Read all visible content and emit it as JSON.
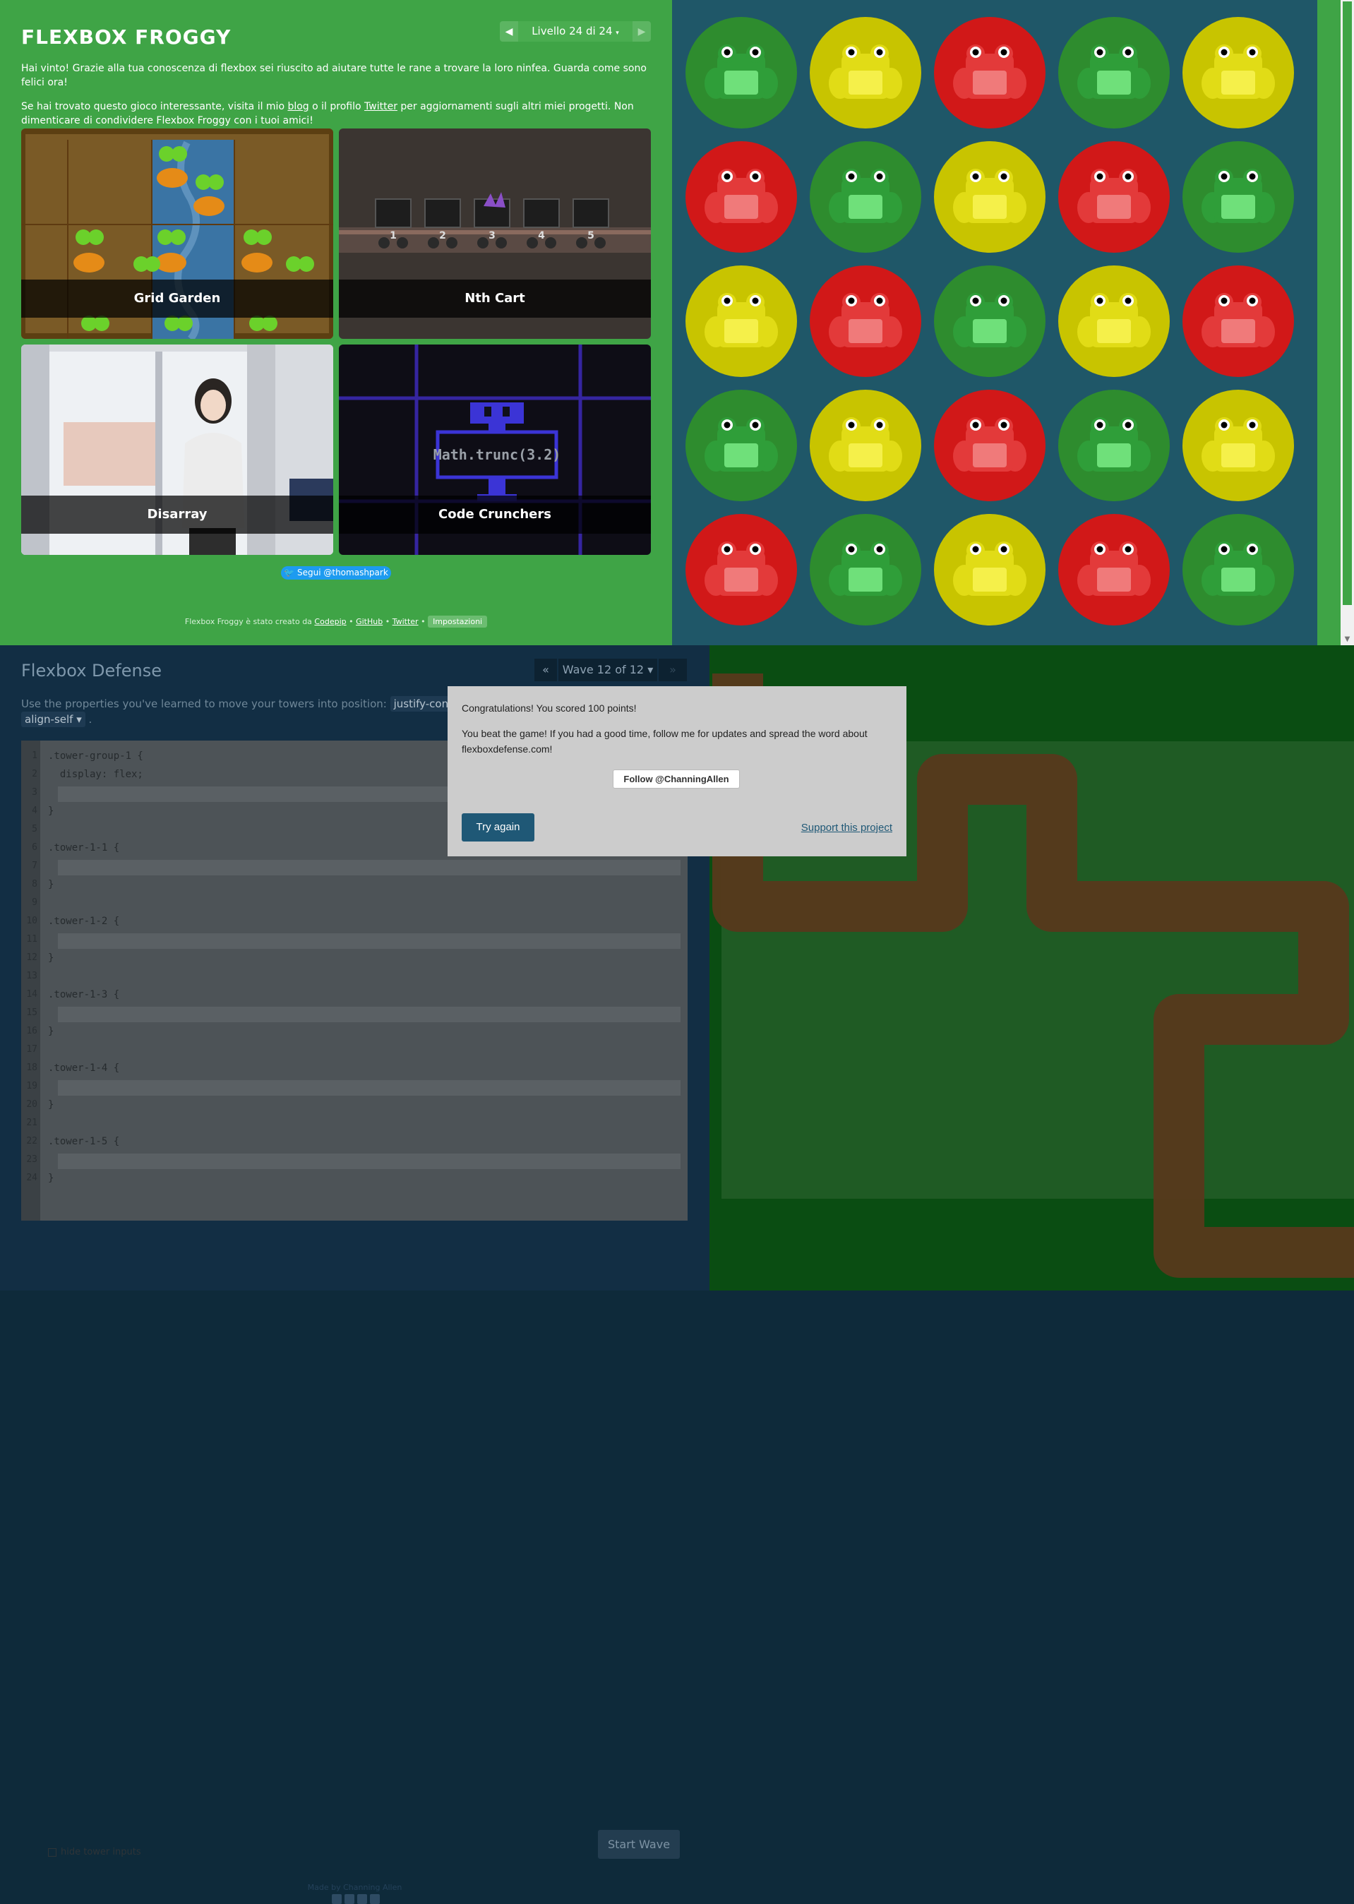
{
  "froggy": {
    "title": "FLEXBOX FROGGY",
    "level_label": "Livello 24 di 24",
    "prev_icon": "triangle-left-icon",
    "next_icon": "triangle-right-icon",
    "win_text": "Hai vinto! Grazie alla tua conoscenza di flexbox sei riuscito ad aiutare tutte le rane a trovare la loro ninfea. Guarda come sono felici ora!",
    "p2_pre": "Se hai trovato questo gioco interessante, visita il mio ",
    "p2_blog": "blog",
    "p2_mid": " o il profilo ",
    "p2_twitter": "Twitter",
    "p2_post": " per aggiornamenti sugli altri miei progetti. Non dimenticare di condividere Flexbox Froggy con i tuoi amici!",
    "games": [
      {
        "label": "Grid Garden"
      },
      {
        "label": "Nth Cart"
      },
      {
        "label": "Disarray"
      },
      {
        "label": "Code Crunchers"
      }
    ],
    "cart_numbers": [
      "1",
      "2",
      "3",
      "4",
      "5"
    ],
    "code_cruncher_text": "Math.trunc(3.2)",
    "twitter_follow": "Segui @thomashpark",
    "footer_pre": "Flexbox Froggy è stato creato da ",
    "footer_codepip": "Codepip",
    "footer_github": "GitHub",
    "footer_twitter": "Twitter",
    "footer_settings": "Impostazioni",
    "pond_colors": {
      "green": "#2e8c2e",
      "yellow": "#c8c400",
      "red": "#d11818"
    },
    "frog_grid": [
      [
        "green",
        "yellow",
        "red",
        "green",
        "yellow"
      ],
      [
        "red",
        "green",
        "yellow",
        "red",
        "green"
      ],
      [
        "yellow",
        "red",
        "green",
        "yellow",
        "red"
      ],
      [
        "green",
        "yellow",
        "red",
        "green",
        "yellow"
      ],
      [
        "red",
        "green",
        "yellow",
        "red",
        "green"
      ]
    ]
  },
  "defense": {
    "title": "Flexbox Defense",
    "wave_prev": "«",
    "wave_label": "Wave 12 of 12",
    "wave_next": "»",
    "desc_pre": "Use the properties you've learned to move your towers into position: ",
    "kw1": "justify-content",
    "kw2": "align-self",
    "code_lines": [
      ".tower-group-1 {",
      "  display: flex;",
      "",
      "}",
      "",
      ".tower-1-1 {",
      "",
      "}",
      "",
      ".tower-1-2 {",
      "",
      "}",
      "",
      ".tower-1-3 {",
      "",
      "}",
      "",
      ".tower-1-4 {",
      "",
      "}",
      "",
      ".tower-1-5 {",
      "",
      "}"
    ],
    "start_wave": "Start Wave",
    "hide_inputs": "hide tower inputs",
    "made_by": "Made by Channing Allen"
  },
  "dialog": {
    "score_text": "Congratulations! You scored 100 points!",
    "beat_text": "You beat the game! If you had a good time, follow me for updates and spread the word about flexboxdefense.com!",
    "follow": "Follow @ChanningAllen",
    "try_again": "Try again",
    "support": "Support this project"
  }
}
